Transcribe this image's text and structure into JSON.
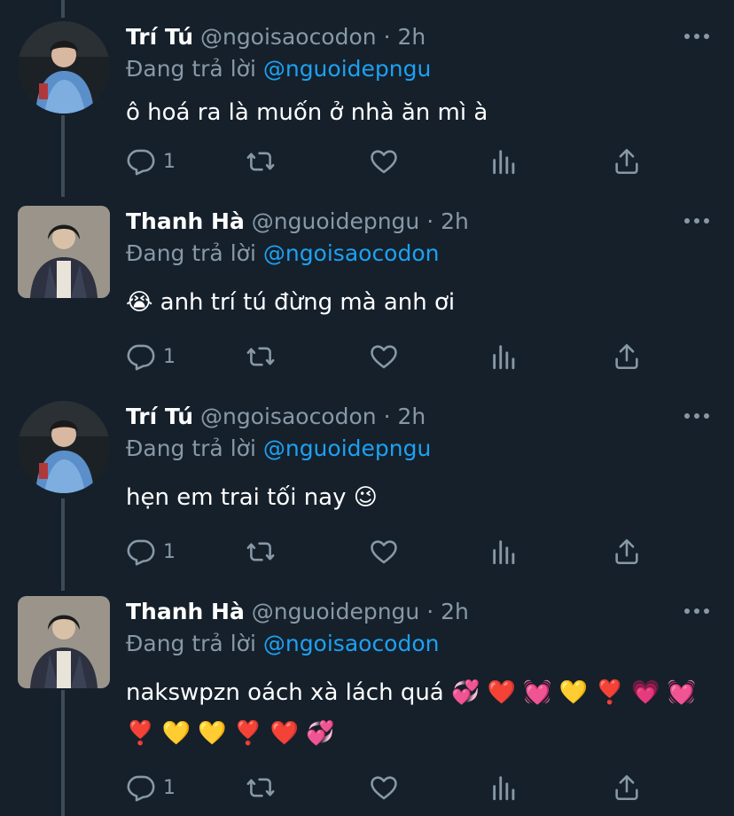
{
  "reply_prefix": "Đang trả lời",
  "tweets": [
    {
      "name": "Trí Tú",
      "handle": "@ngoisaocodon",
      "sep": "·",
      "time": "2h",
      "reply_mention": "@nguoidepngu",
      "text": "ô hoá ra là muốn ở nhà ăn mì à",
      "reply_count": "1",
      "avatar_icon": "avatar-photo-tri-tu"
    },
    {
      "name": "Thanh Hà",
      "handle": "@nguoidepngu",
      "sep": "·",
      "time": "2h",
      "reply_mention": "@ngoisaocodon",
      "text": "😭  anh trí tú đừng mà anh ơi",
      "reply_count": "1",
      "avatar_icon": "avatar-photo-thanh-ha"
    },
    {
      "name": "Trí Tú",
      "handle": "@ngoisaocodon",
      "sep": "·",
      "time": "2h",
      "reply_mention": "@nguoidepngu",
      "text": "hẹn em trai tối nay 😉",
      "reply_count": "1",
      "avatar_icon": "avatar-photo-tri-tu"
    },
    {
      "name": "Thanh Hà",
      "handle": "@nguoidepngu",
      "sep": "·",
      "time": "2h",
      "reply_mention": "@ngoisaocodon",
      "text": "nakswpzn oách xà lách quá 💞 ❤️ 💓 💛 ❣️ 💗 💓 ❣️ 💛 💛 ❣️ ❤️ 💞",
      "reply_count": "1",
      "avatar_icon": "avatar-photo-thanh-ha"
    }
  ],
  "colors": {
    "background": "#15202b",
    "text": "#ffffff",
    "secondary": "#8899a6",
    "accent": "#1da1f2",
    "thread_line": "#3d4b57"
  },
  "icons": [
    "reply-icon",
    "retweet-icon",
    "like-icon",
    "analytics-icon",
    "share-icon",
    "more-icon"
  ]
}
